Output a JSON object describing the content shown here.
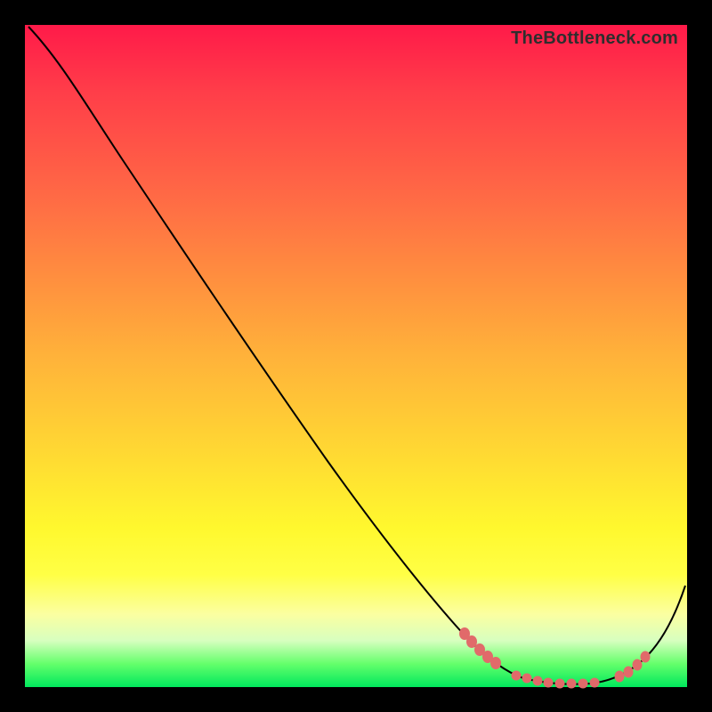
{
  "watermark": "TheBottleneck.com",
  "colors": {
    "dot": "#e16a6a",
    "line": "#000000"
  },
  "chart_data": {
    "type": "line",
    "title": "",
    "xlabel": "",
    "ylabel": "",
    "xlim": [
      0,
      100
    ],
    "ylim": [
      0,
      100
    ],
    "grid": false,
    "legend": false,
    "series": [
      {
        "name": "curve",
        "x": [
          0,
          3,
          8,
          15,
          25,
          35,
          45,
          55,
          63,
          68,
          72,
          76,
          80,
          84,
          88,
          92,
          96,
          100
        ],
        "y": [
          100,
          98,
          94,
          87,
          74,
          60,
          46,
          32,
          20,
          12,
          6,
          3,
          1,
          0,
          0,
          3,
          10,
          22
        ]
      }
    ],
    "highlight_dots": {
      "left_segment": {
        "x_start": 66,
        "x_end": 71,
        "count": 5
      },
      "flat_segment": {
        "x_start": 74,
        "x_end": 88,
        "count": 8
      },
      "right_segment": {
        "x_start": 90,
        "x_end": 94,
        "count": 4
      }
    }
  }
}
